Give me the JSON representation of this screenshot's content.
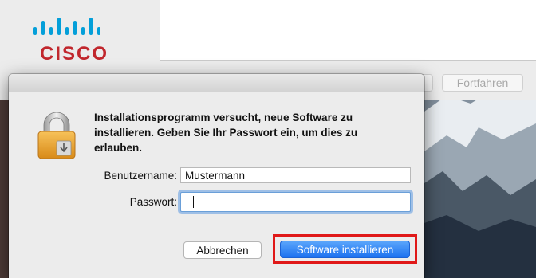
{
  "app": {
    "brand": "CISCO"
  },
  "installer": {
    "continue_label": "Fortfahren"
  },
  "dialog": {
    "message": "Installationsprogramm versucht, neue Software zu installieren. Geben Sie Ihr Passwort ein, um dies zu erlauben.",
    "username_label": "Benutzername:",
    "username_value": "Mustermann",
    "password_label": "Passwort:",
    "password_value": "",
    "cancel_label": "Abbrechen",
    "install_label": "Software installieren"
  },
  "icons": {
    "lock": "lock-icon",
    "logo": "cisco-logo"
  },
  "colors": {
    "brand_red": "#c1272d",
    "cisco_blue": "#049fd9",
    "primary_button": "#1d72f0",
    "highlight": "#e01919"
  }
}
